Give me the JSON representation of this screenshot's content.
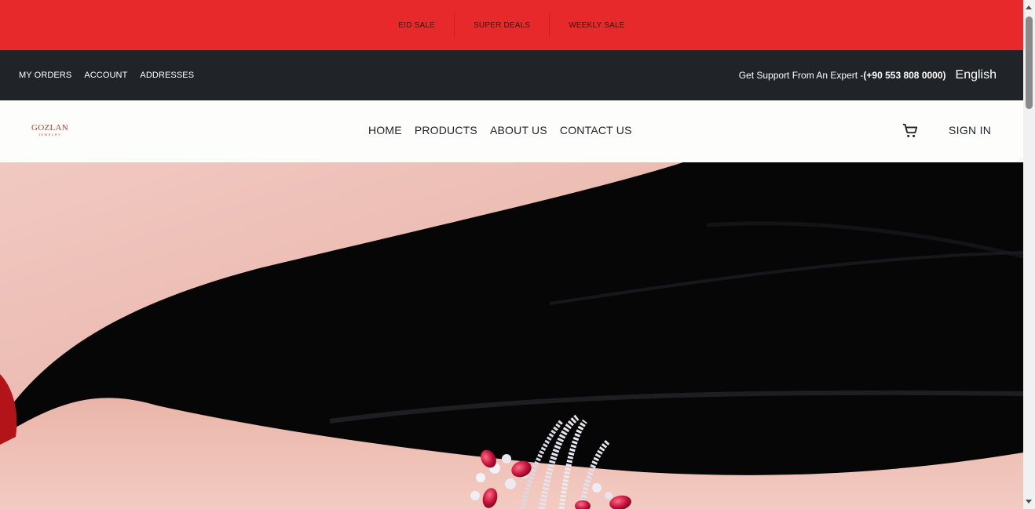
{
  "promo": {
    "items": [
      "EID SALE",
      "SUPER DEALS",
      "WEEKLY SALE"
    ]
  },
  "util": {
    "links": [
      "MY ORDERS",
      "ACCOUNT",
      "ADDRESSES"
    ],
    "support_text": "Get Support From An Expert -",
    "support_phone": "(+90 553 808 0000)",
    "language": "English"
  },
  "nav": {
    "logo_main": "GOZLAN",
    "logo_sub": "JEWELRY",
    "links": [
      "HOME",
      "PRODUCTS",
      "ABOUT US",
      "CONTACT US"
    ],
    "cart_icon": "shopping-cart-icon",
    "signin": "SIGN IN"
  },
  "colors": {
    "promo_bg": "#e8292b",
    "util_bg": "#202428",
    "nav_bg": "#fdfdfc",
    "brand": "#c0392b"
  }
}
